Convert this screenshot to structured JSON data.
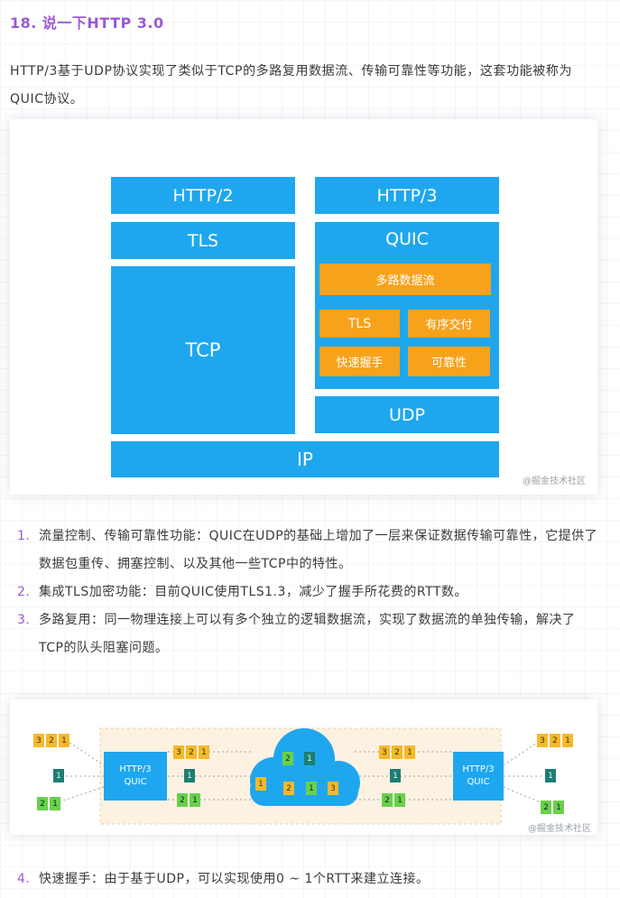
{
  "heading": "18. 说一下HTTP 3.0",
  "intro": "HTTP/3基于UDP协议实现了类似于TCP的多路复用数据流、传输可靠性等功能，这套功能被称为QUIC协议。",
  "figure1": {
    "left_stack": {
      "top": "HTTP/2",
      "mid": "TLS",
      "base": "TCP"
    },
    "right_stack": {
      "top": "HTTP/3",
      "quic": "QUIC",
      "features": [
        "多路数据流",
        "TLS",
        "有序交付",
        "快速握手",
        "可靠性"
      ],
      "base": "UDP"
    },
    "bottom": "IP",
    "watermark": "@掘金技术社区",
    "colors": {
      "blue": "#1ea7ef",
      "orange": "#f7a21b"
    }
  },
  "list1": [
    {
      "num": "1.",
      "text": "流量控制、传输可靠性功能：QUIC在UDP的基础上增加了一层来保证数据传输可靠性，它提供了数据包重传、拥塞控制、以及其他一些TCP中的特性。"
    },
    {
      "num": "2.",
      "text": "集成TLS加密功能：目前QUIC使用TLS1.3，减少了握手所花费的RTT数。"
    },
    {
      "num": "3.",
      "text": "多路复用：同一物理连接上可以有多个独立的逻辑数据流，实现了数据流的单独传输，解决了TCP的队头阻塞问题。"
    }
  ],
  "figure2": {
    "left_node": "HTTP/3 QUIC",
    "right_node": "HTTP/3 QUIC",
    "yellow_stream": [
      "3",
      "2",
      "1"
    ],
    "teal_stream": [
      "1"
    ],
    "green_stream": [
      "2",
      "1"
    ],
    "cloud_packets": [
      "2",
      "1",
      "2",
      "1",
      "3"
    ],
    "watermark": "@掘金技术社区",
    "colors": {
      "yellow": "#f6b928",
      "teal": "#1c7f73",
      "green": "#69d14a",
      "cloud": "#1ea7ef",
      "band": "#fdf1e2"
    }
  },
  "list2": [
    {
      "num": "4.",
      "text": "快速握手：由于基于UDP，可以实现使用0 ~ 1个RTT来建立连接。"
    }
  ]
}
